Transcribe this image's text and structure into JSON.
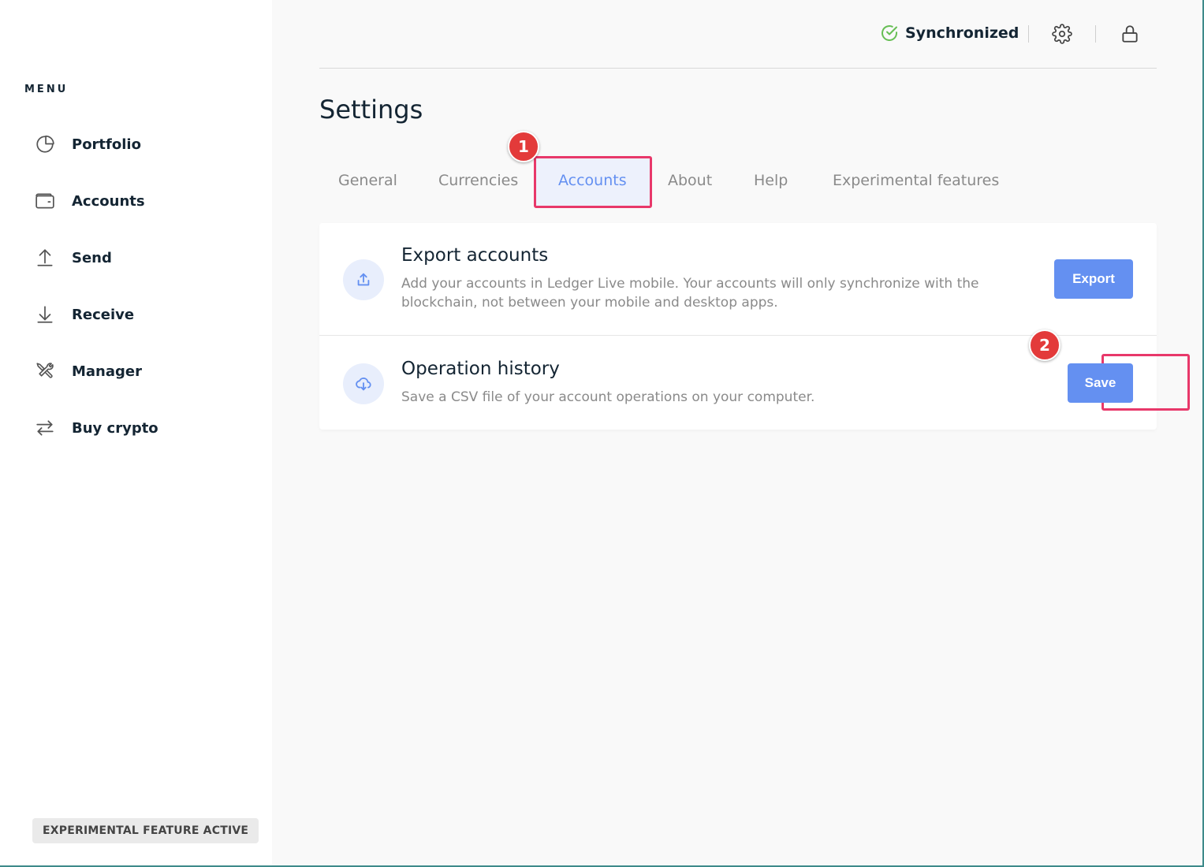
{
  "sidebar": {
    "menu_label": "MENU",
    "items": [
      {
        "label": "Portfolio",
        "icon": "pie-chart-icon"
      },
      {
        "label": "Accounts",
        "icon": "wallet-icon"
      },
      {
        "label": "Send",
        "icon": "arrow-up-icon"
      },
      {
        "label": "Receive",
        "icon": "arrow-down-icon"
      },
      {
        "label": "Manager",
        "icon": "tools-icon"
      },
      {
        "label": "Buy crypto",
        "icon": "exchange-icon"
      }
    ],
    "experimental_badge": "EXPERIMENTAL FEATURE ACTIVE"
  },
  "topbar": {
    "sync_status": "Synchronized",
    "sync_color": "#66be54"
  },
  "page": {
    "title": "Settings"
  },
  "tabs": [
    {
      "label": "General",
      "active": false
    },
    {
      "label": "Currencies",
      "active": false
    },
    {
      "label": "Accounts",
      "active": true
    },
    {
      "label": "About",
      "active": false
    },
    {
      "label": "Help",
      "active": false
    },
    {
      "label": "Experimental features",
      "active": false
    }
  ],
  "annotations": {
    "step1": "1",
    "step2": "2"
  },
  "export_row": {
    "title": "Export accounts",
    "description": "Add your accounts in Ledger Live mobile. Your accounts will only synchronize with the blockchain, not between your mobile and desktop apps.",
    "button": "Export"
  },
  "history_row": {
    "title": "Operation history",
    "description": "Save a CSV file of your account operations on your computer.",
    "button": "Save"
  },
  "colors": {
    "accent": "#6490f1",
    "highlight": "#e8386a",
    "annotation": "#e33a3a"
  }
}
